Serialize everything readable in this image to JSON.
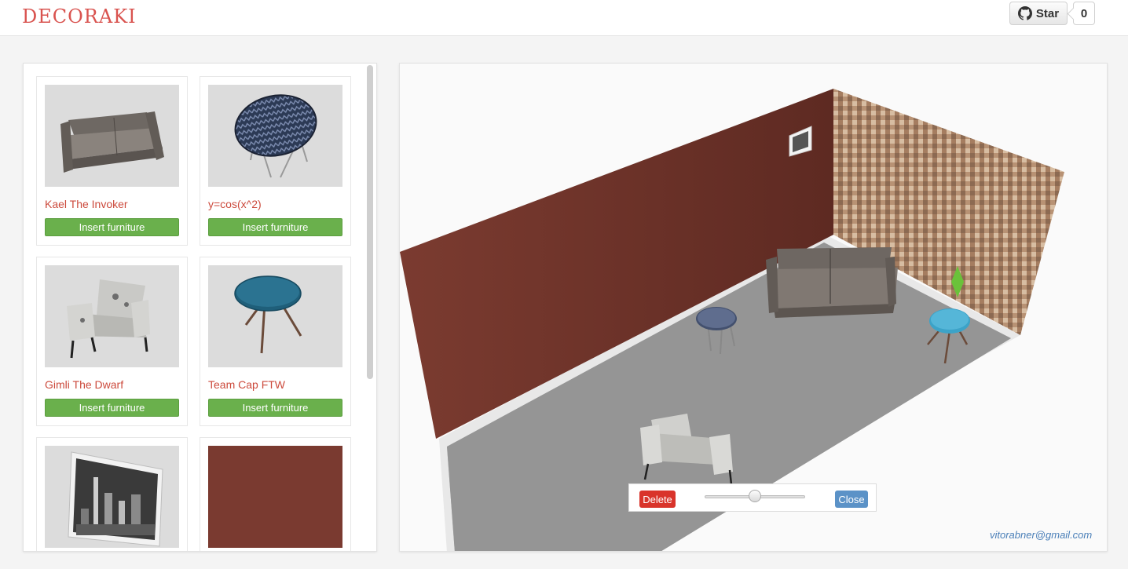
{
  "header": {
    "logo": "DECORAKI",
    "github": {
      "star_label": "Star",
      "star_count": "0",
      "icon": "github-icon"
    }
  },
  "catalog": {
    "insert_label": "Insert furniture",
    "items": [
      {
        "title": "Kael The Invoker",
        "image": "sofa"
      },
      {
        "title": "y=cos(x^2)",
        "image": "round-patterned-table"
      },
      {
        "title": "Gimli The Dwarf",
        "image": "armchair"
      },
      {
        "title": "Team Cap FTW",
        "image": "blue-round-table"
      },
      {
        "title": "",
        "image": "city-picture-frame"
      },
      {
        "title": "",
        "image": "wall-color-swatch"
      }
    ]
  },
  "viewer": {
    "controls": {
      "delete_label": "Delete",
      "close_label": "Close",
      "scale_slider_value": 0.5
    },
    "contact": "vitorabner@gmail.com"
  },
  "colors": {
    "brand": "#d9534f",
    "insert_button": "#6ab04c",
    "delete_button": "#d9342b",
    "close_button": "#5b92c7",
    "wall": "#7a3a30"
  }
}
